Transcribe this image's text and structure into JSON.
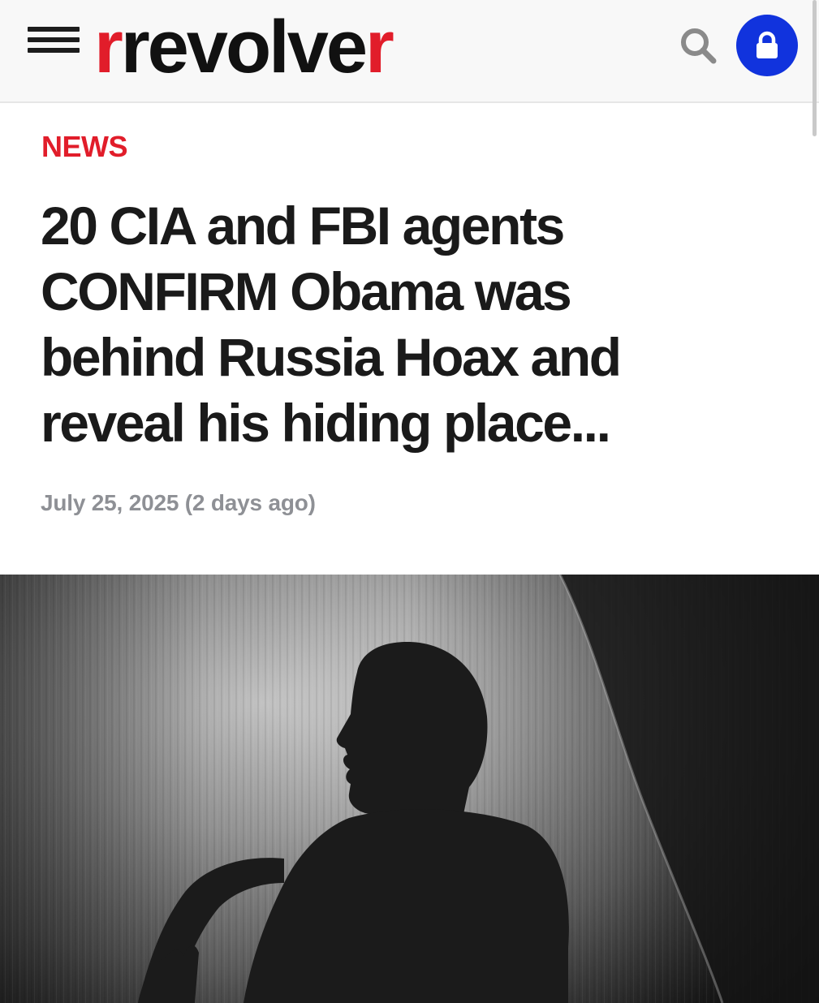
{
  "header": {
    "logo_main": "revolve",
    "logo_r_start": "r",
    "logo_r_end": "r",
    "icons": [
      "menu-icon",
      "search-icon",
      "lock-icon"
    ],
    "colors": {
      "brand_red": "#e11d2a",
      "lock_blue": "#1133dd"
    }
  },
  "article": {
    "category": "NEWS",
    "headline": "20 CIA and FBI agents CONFIRM Obama was behind Russia Hoax and reveal his hiding place...",
    "date": "July 25, 2025 (2 days ago)"
  }
}
